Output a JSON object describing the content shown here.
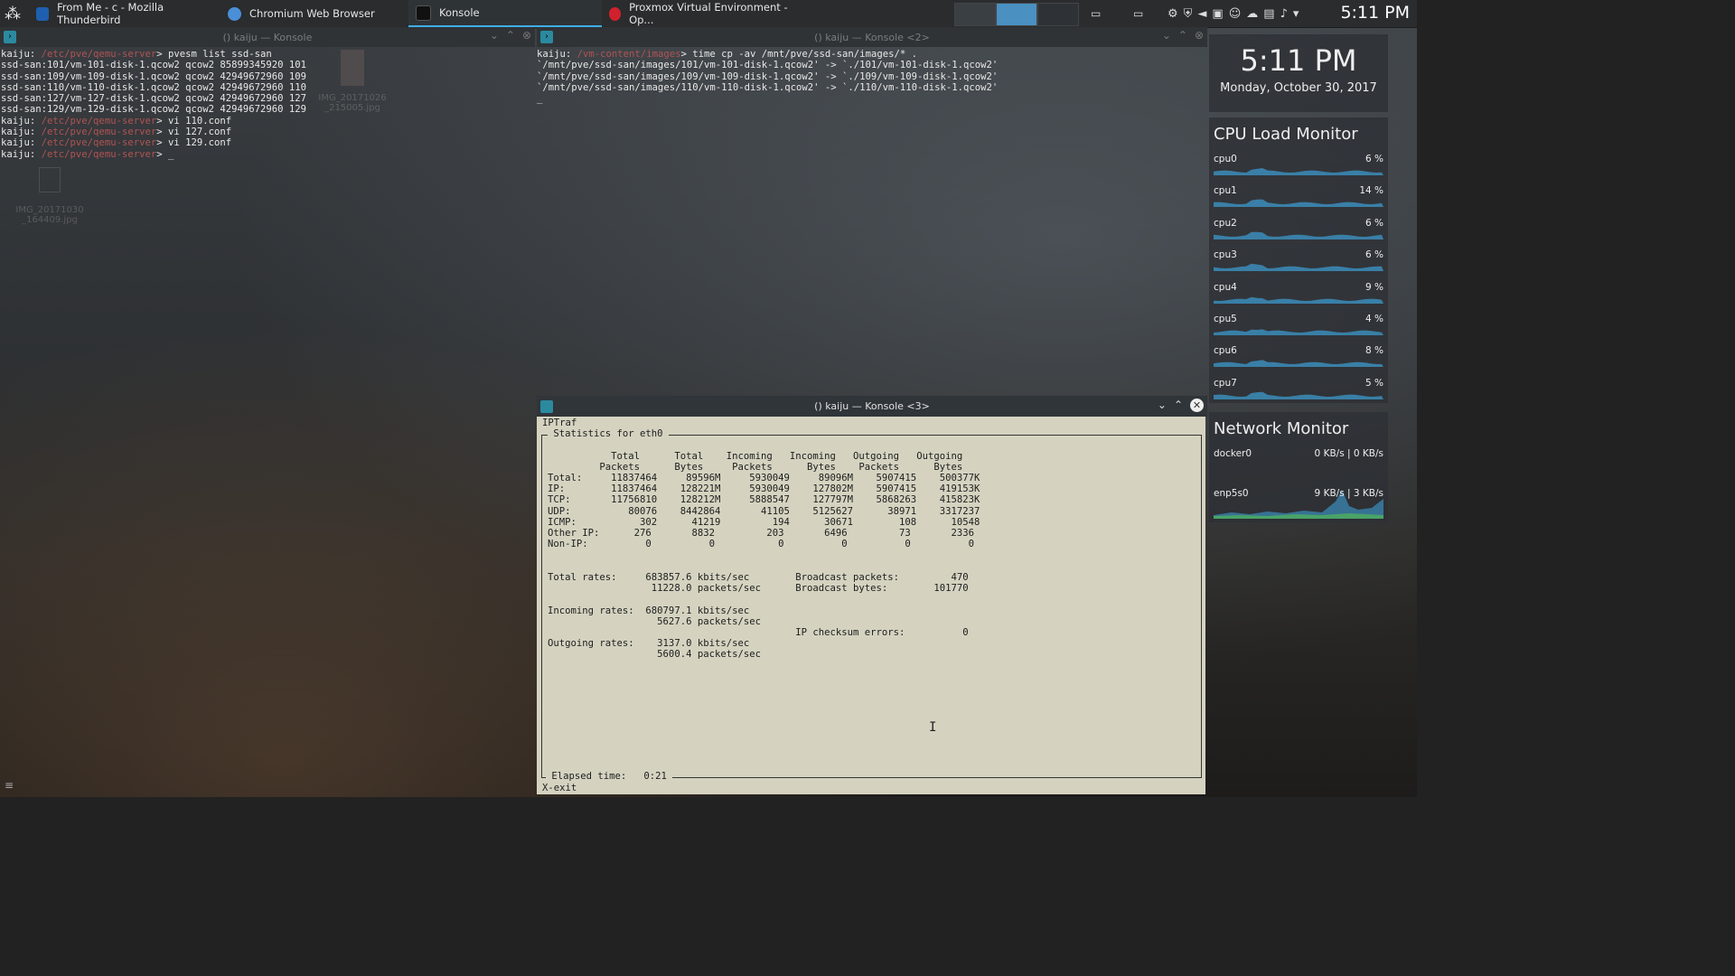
{
  "taskbar": {
    "tasks": [
      {
        "label": "From Me - c - Mozilla Thunderbird",
        "icon": "thunderbird-icon",
        "color": "#1f5fb0"
      },
      {
        "label": "Chromium Web Browser",
        "icon": "chromium-icon",
        "color": "#4a8fd8"
      },
      {
        "label": "Konsole",
        "icon": "konsole-icon",
        "color": "#222"
      },
      {
        "label": "Proxmox Virtual Environment - Op...",
        "icon": "opera-icon",
        "color": "#d0212d"
      }
    ],
    "clock": "5:11 PM"
  },
  "konsole1": {
    "title": "() kaiju — Konsole",
    "lines": [
      {
        "prompt": "kaiju: ",
        "path": "/etc/pve/qemu-server",
        "cmd": "> pvesm list ssd-san"
      },
      {
        "text": "ssd-san:101/vm-101-disk-1.qcow2 qcow2 85899345920 101"
      },
      {
        "text": "ssd-san:109/vm-109-disk-1.qcow2 qcow2 42949672960 109"
      },
      {
        "text": "ssd-san:110/vm-110-disk-1.qcow2 qcow2 42949672960 110"
      },
      {
        "text": "ssd-san:127/vm-127-disk-1.qcow2 qcow2 42949672960 127"
      },
      {
        "text": "ssd-san:129/vm-129-disk-1.qcow2 qcow2 42949672960 129"
      },
      {
        "prompt": "kaiju: ",
        "path": "/etc/pve/qemu-server",
        "cmd": "> vi 110.conf"
      },
      {
        "prompt": "kaiju: ",
        "path": "/etc/pve/qemu-server",
        "cmd": "> vi 127.conf"
      },
      {
        "prompt": "kaiju: ",
        "path": "/etc/pve/qemu-server",
        "cmd": "> vi 129.conf"
      },
      {
        "prompt": "kaiju: ",
        "path": "/etc/pve/qemu-server",
        "cmd": "> _"
      }
    ]
  },
  "konsole2": {
    "title": "() kaiju — Konsole <2>",
    "lines": [
      {
        "prompt": "kaiju: ",
        "path": "/vm-content/images",
        "cmd": "> time cp -av /mnt/pve/ssd-san/images/* ."
      },
      {
        "text": "`/mnt/pve/ssd-san/images/101/vm-101-disk-1.qcow2' -> `./101/vm-101-disk-1.qcow2'"
      },
      {
        "text": "`/mnt/pve/ssd-san/images/109/vm-109-disk-1.qcow2' -> `./109/vm-109-disk-1.qcow2'"
      },
      {
        "text": "`/mnt/pve/ssd-san/images/110/vm-110-disk-1.qcow2' -> `./110/vm-110-disk-1.qcow2'"
      },
      {
        "text": "_"
      }
    ]
  },
  "desktop_icons": [
    {
      "label": "IMG_20171026\n_215005.jpg"
    },
    {
      "label": "IMG_20171030\n_164409.jpg"
    }
  ],
  "konsole3": {
    "title": "() kaiju — Konsole <3>",
    "app": "IPTraf",
    "box_title": " Statistics for eth0 ",
    "header1": "           Total      Total    Incoming   Incoming   Outgoing   Outgoing",
    "header2": "         Packets      Bytes     Packets      Bytes    Packets      Bytes",
    "rows": [
      "Total:     11837464     89596M     5930049     89096M    5907415    500377K",
      "IP:        11837464    128221M     5930049    127802M    5907415    419153K",
      "TCP:       11756810    128212M     5888547    127797M    5868263    415823K",
      "UDP:          80076    8442864       41105    5125627      38971    3317237",
      "ICMP:           302      41219         194      30671        108      10548",
      "Other IP:      276       8832         203       6496         73       2336",
      "Non-IP:          0          0           0          0          0          0"
    ],
    "rates": [
      "Total rates:     683857.6 kbits/sec        Broadcast packets:         470",
      "                  11228.0 packets/sec      Broadcast bytes:        101770",
      "",
      "Incoming rates:  680797.1 kbits/sec",
      "                   5627.6 packets/sec",
      "                                           IP checksum errors:          0",
      "Outgoing rates:    3137.0 kbits/sec",
      "                   5600.4 packets/sec"
    ],
    "elapsed": " Elapsed time:   0:21 ",
    "footer": "X-exit"
  },
  "clock_widget": {
    "time": "5:11 PM",
    "date": "Monday, October 30, 2017"
  },
  "cpu_monitor": {
    "title": "CPU Load Monitor",
    "color": "#3d9fd6",
    "cpus": [
      {
        "name": "cpu0",
        "value": "6 %"
      },
      {
        "name": "cpu1",
        "value": "14 %"
      },
      {
        "name": "cpu2",
        "value": "6 %"
      },
      {
        "name": "cpu3",
        "value": "6 %"
      },
      {
        "name": "cpu4",
        "value": "9 %"
      },
      {
        "name": "cpu5",
        "value": "4 %"
      },
      {
        "name": "cpu6",
        "value": "8 %"
      },
      {
        "name": "cpu7",
        "value": "5 %"
      }
    ]
  },
  "network_monitor": {
    "title": "Network Monitor",
    "interfaces": [
      {
        "name": "docker0",
        "value": "0 KB/s | 0 KB/s"
      },
      {
        "name": "enp5s0",
        "value": "9 KB/s | 3 KB/s"
      }
    ]
  }
}
